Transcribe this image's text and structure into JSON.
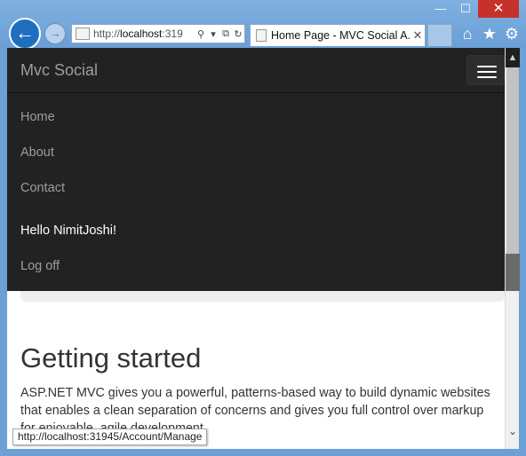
{
  "window": {
    "minimize": "—",
    "maximize": "☐",
    "close": "✕"
  },
  "browser": {
    "back_icon": "←",
    "forward_icon": "→",
    "address": {
      "url_prefix": "http://",
      "url_host": "localhost",
      "url_rest": ":319",
      "search_icon": "⚲",
      "dropdown_icon": "▾",
      "compat_icon": "⧉",
      "refresh_icon": "↻"
    },
    "tab": {
      "title": "Home Page - MVC Social A...",
      "close": "✕"
    },
    "tools": {
      "home": "⌂",
      "favorites": "★",
      "settings": "⚙"
    }
  },
  "site": {
    "brand": "Mvc Social",
    "nav": [
      "Home",
      "About",
      "Contact"
    ],
    "user_greeting": "Hello NimitJoshi!",
    "logoff": "Log off"
  },
  "content": {
    "heading": "Getting started",
    "paragraph": "ASP.NET MVC gives you a powerful, patterns-based way to build dynamic websites that enables a clean separation of concerns and gives you full control over markup for enjoyable, agile development."
  },
  "scrollbar": {
    "up": "▲",
    "down": "⌄"
  },
  "status_bar": {
    "url": "http://localhost:31945/Account/Manage"
  }
}
